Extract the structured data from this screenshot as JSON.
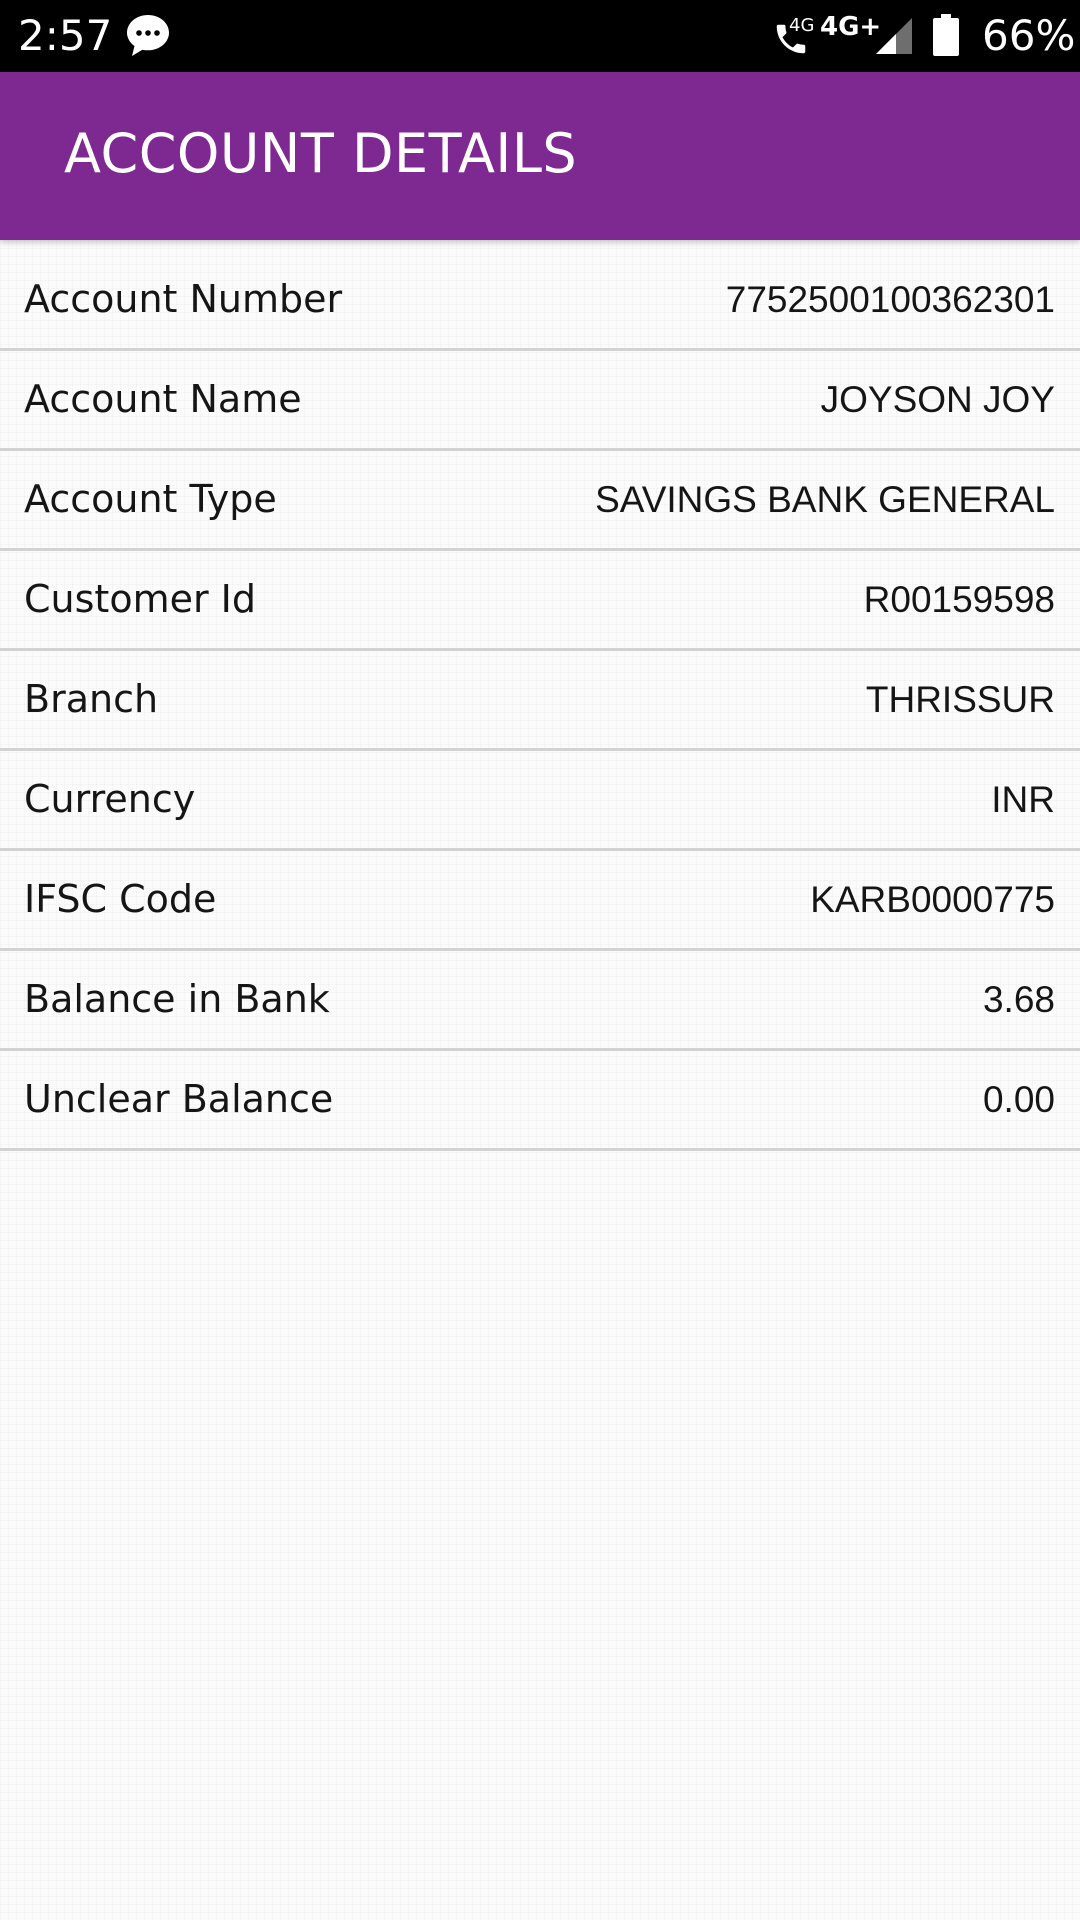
{
  "status_bar": {
    "time": "2:57",
    "call_network_label": "4G",
    "network_type": "4G+",
    "battery_percent": "66%",
    "icons": [
      "message-icon",
      "volte-call-icon",
      "signal-icon",
      "battery-icon"
    ]
  },
  "header": {
    "title": "ACCOUNT DETAILS",
    "background_color": "#7e2991"
  },
  "details": [
    {
      "label": "Account Number",
      "value": "7752500100362301"
    },
    {
      "label": "Account Name",
      "value": "JOYSON JOY"
    },
    {
      "label": "Account Type",
      "value": "SAVINGS BANK GENERAL"
    },
    {
      "label": "Customer Id",
      "value": "R00159598"
    },
    {
      "label": "Branch",
      "value": "THRISSUR"
    },
    {
      "label": "Currency",
      "value": "INR"
    },
    {
      "label": "IFSC Code",
      "value": "KARB0000775"
    },
    {
      "label": "Balance in Bank",
      "value": "3.68"
    },
    {
      "label": "Unclear Balance",
      "value": "0.00"
    }
  ]
}
